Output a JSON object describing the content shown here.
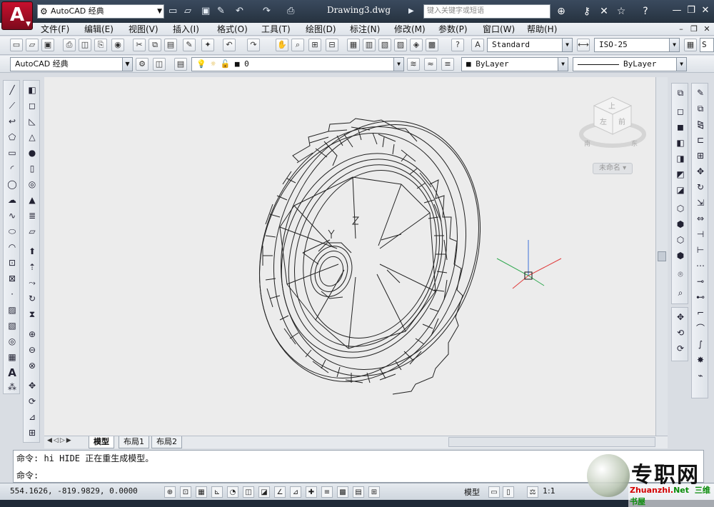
{
  "app": {
    "logo_letter": "A",
    "workspace": "AutoCAD 经典",
    "document_title": "Drawing3.dwg",
    "search_placeholder": "键入关键字或短语"
  },
  "menus": [
    "文件(F)",
    "编辑(E)",
    "视图(V)",
    "插入(I)",
    "格式(O)",
    "工具(T)",
    "绘图(D)",
    "标注(N)",
    "修改(M)",
    "参数(P)",
    "窗口(W)",
    "帮助(H)"
  ],
  "toolbar": {
    "text_style": "Standard",
    "dim_style": "ISO-25",
    "workspace2": "AutoCAD 经典",
    "layer": "0",
    "color": "ByLayer",
    "linetype": "ByLayer"
  },
  "viewcube": {
    "top": "上",
    "front": "左",
    "right": "前",
    "south": "南",
    "east": "东",
    "ucs": "未命名"
  },
  "tabs": [
    "模型",
    "布局1",
    "布局2"
  ],
  "command": {
    "history": "命令: hi HIDE 正在重生成模型。",
    "prompt": "命令:"
  },
  "status": {
    "coords": "554.1626, -819.9829, 0.0000",
    "model_label": "模型",
    "scale": "1:1"
  },
  "watermark": {
    "title": "专职网",
    "url_red": "Zhuanzhi.",
    "url_green": "Net",
    "sub": "三维书屋"
  },
  "icons": {
    "app": "autocad-logo",
    "new": "new-file-icon",
    "open": "open-file-icon",
    "save": "save-icon",
    "undo": "undo-icon",
    "redo": "redo-icon",
    "print": "print-icon",
    "binoculars": "binoculars-icon",
    "star": "favorite-icon",
    "help": "help-icon"
  },
  "colors": {
    "title_bg": "#26323f",
    "drawing_bg": "#ececec",
    "ucs_x": "#e03b3b",
    "ucs_y": "#2fa84f",
    "ucs_z": "#3b6fd8"
  }
}
